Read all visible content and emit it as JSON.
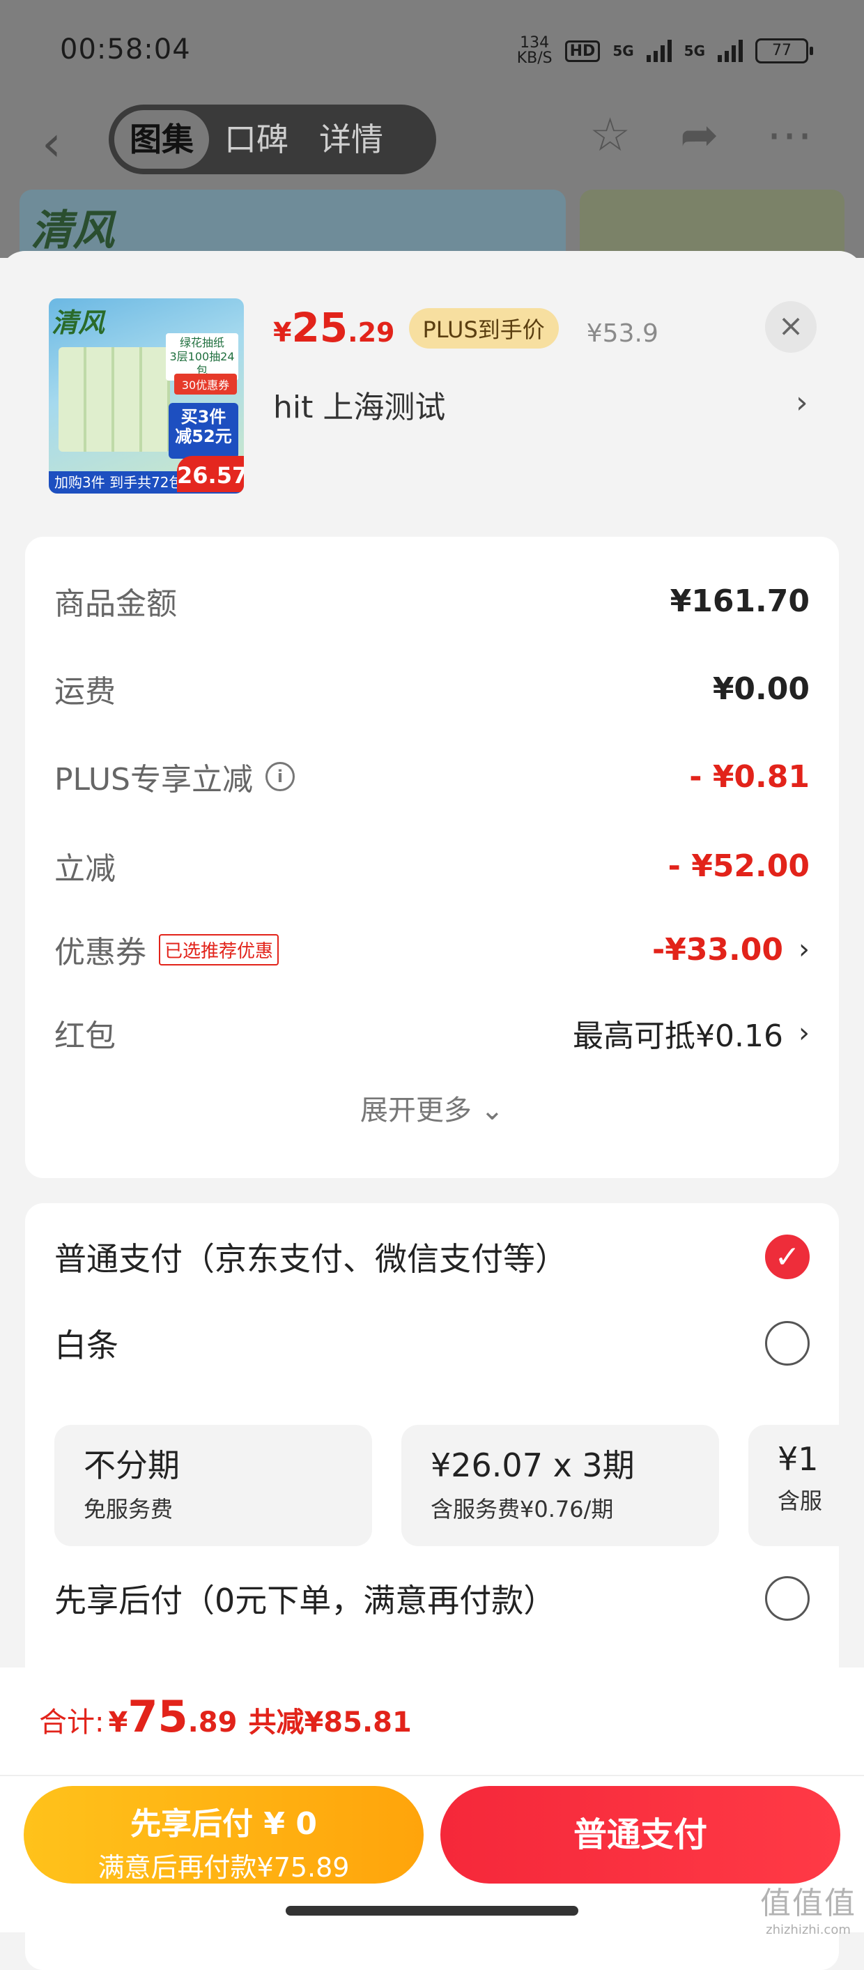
{
  "status_bar": {
    "time": "00:58:04",
    "net_speed": "134",
    "net_unit": "KB/S",
    "hd": "HD",
    "sig1": "5G",
    "sig2": "5G",
    "battery": "77"
  },
  "nav": {
    "tabs": [
      "图集",
      "口碑",
      "详情"
    ],
    "active_tab": 0
  },
  "product": {
    "image_texts": {
      "logo": "清风",
      "label": "绿花抽纸\n3层100抽24包",
      "tag": "30优惠券",
      "deal": "买3件\n减52元",
      "bottom": "加购3件 到手共72包",
      "price": "26.57"
    },
    "price_symbol": "¥",
    "price_int": "25",
    "price_dec": ".29",
    "plus_badge": "PLUS到手价",
    "original_price": "¥53.9",
    "store": "hit  上海测试"
  },
  "fees": {
    "items": [
      {
        "label": "商品金额",
        "value": "¥161.70"
      },
      {
        "label": "运费",
        "value": "¥0.00"
      },
      {
        "label": "PLUS专享立减",
        "value": "- ¥0.81"
      },
      {
        "label": "立减",
        "value": "- ¥52.00"
      },
      {
        "label": "优惠券",
        "tag": "已选推荐优惠",
        "value": "-¥33.00"
      },
      {
        "label": "红包",
        "value": "最高可抵¥0.16"
      }
    ],
    "expand": "展开更多"
  },
  "payment": {
    "normal": "普通支付（京东支付、微信支付等）",
    "baitiao": "白条",
    "plans": [
      {
        "title": "不分期",
        "sub": "免服务费"
      },
      {
        "title": "¥26.07 x 3期",
        "sub": "含服务费¥0.76/期"
      },
      {
        "title": "¥1",
        "sub": "含服"
      }
    ],
    "later": "先享后付（0元下单，满意再付款）"
  },
  "footer": {
    "total_label": "合计:",
    "total_sym": "¥",
    "total_int": "75",
    "total_dec": ".89",
    "save": "共减¥85.81",
    "later_btn_line1": "先享后付 ¥ 0",
    "later_btn_line2": "满意后再付款¥75.89",
    "pay_btn": "普通支付"
  },
  "watermark": {
    "line1": "值值值",
    "line2": "zhizhizhi.com"
  }
}
